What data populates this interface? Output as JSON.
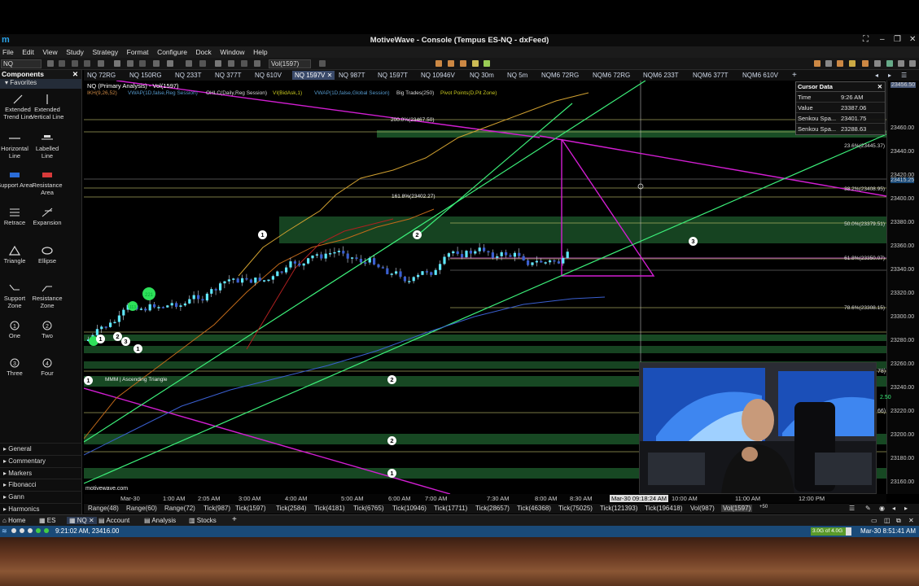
{
  "window": {
    "title": "MotiveWave - Console (Tempus ES-NQ - dxFeed)"
  },
  "menu": [
    "File",
    "Edit",
    "View",
    "Study",
    "Strategy",
    "Format",
    "Configure",
    "Dock",
    "Window",
    "Help"
  ],
  "toolbar": {
    "symbol": "NQ",
    "bartype": "Vol(1597)"
  },
  "sidebar": {
    "title": "Components",
    "favorites_label": "Favorites",
    "tools": [
      {
        "label": "Extended Trend Line",
        "icon": "trend-line-icon"
      },
      {
        "label": "Extended Vertical Line",
        "icon": "vertical-line-icon"
      },
      {
        "label": "Horizontal Line",
        "icon": "horizontal-line-icon"
      },
      {
        "label": "Labelled Line",
        "icon": "labelled-line-icon"
      },
      {
        "label": "Support Area",
        "icon": "support-area-icon"
      },
      {
        "label": "Resistance Area",
        "icon": "resistance-area-icon"
      },
      {
        "label": "Retrace",
        "icon": "retrace-icon"
      },
      {
        "label": "Expansion",
        "icon": "expansion-icon"
      },
      {
        "label": "Triangle",
        "icon": "triangle-icon"
      },
      {
        "label": "Ellipse",
        "icon": "ellipse-icon"
      },
      {
        "label": "Support Zone",
        "icon": "support-zone-icon"
      },
      {
        "label": "Resistance Zone",
        "icon": "resistance-zone-icon"
      },
      {
        "label": "One",
        "icon": "one-icon"
      },
      {
        "label": "Two",
        "icon": "two-icon"
      },
      {
        "label": "Three",
        "icon": "three-icon"
      },
      {
        "label": "Four",
        "icon": "four-icon"
      }
    ],
    "categories": [
      "General",
      "Commentary",
      "Markers",
      "Fibonacci",
      "Gann",
      "Harmonics"
    ]
  },
  "chart_tabs": [
    "NQ 72RG",
    "NQ 150RG",
    "NQ 233T",
    "NQ 377T",
    "NQ 610V",
    "NQ 1597V",
    "NQ 987T",
    "NQ 1597T",
    "NQ 10946V",
    "NQ 30m",
    "NQ 5m",
    "NQM6 72RG",
    "NQM6 72RG",
    "NQM6 233T",
    "NQM6 377T",
    "NQM6 610V"
  ],
  "chart": {
    "header": "NQ (Primary Analysis) - Vol(1597)",
    "studies": [
      "IKH(9,26,52)",
      "VWAP(1D,false,Reg Session)",
      "OHLC(Daily,Reg Session)",
      "VI(BidAsk,1)",
      "VWAP(1D,false,Global Session)",
      "Big Trades(250)",
      "Pivot Points(D,Pit Zone)"
    ],
    "watermark": "motivewave.com",
    "pattern_label": "MMM | Ascending Triangle",
    "fib_labels": [
      {
        "text": "200.0%(23467.50)"
      },
      {
        "text": "161.8%(23402.27)"
      },
      {
        "text": "23.6%(23445.37)"
      },
      {
        "text": "38.2%(23408.95)"
      },
      {
        "text": "50.0%(23379.51)"
      },
      {
        "text": "61.8%(23350.07)"
      },
      {
        "text": "78.6%(23308.15)"
      }
    ],
    "wave_labels": [
      "1",
      "2",
      "3",
      "1",
      "1",
      "2",
      "3",
      "1",
      "2",
      "2",
      "1"
    ],
    "green_bubbles": [
      "221",
      "113"
    ],
    "price_labels": [
      "23456.50",
      "23460.00",
      "23440.00",
      "23420.00",
      "23415.25",
      "23400.00",
      "23380.00",
      "23360.00",
      "23340.00",
      "23320.00",
      "23300.00",
      "23280.00",
      "23260.00",
      "23240.00",
      "23220.00",
      "23200.00",
      "23180.00",
      "23160.00"
    ],
    "price_partial": [
      "78)",
      "2.50",
      "66)"
    ],
    "time_labels": [
      "Mar-30",
      "1:00 AM",
      "2:05 AM",
      "3:00 AM",
      "4:00 AM",
      "5:00 AM",
      "6:00 AM",
      "7:00 AM",
      "7:30 AM",
      "8:00 AM",
      "8:30 AM",
      "10:00 AM",
      "11:00 AM",
      "12:00 PM"
    ],
    "cursor_time": "Mar-30 09:18:24 AM"
  },
  "cursor_data": {
    "title": "Cursor Data",
    "rows": [
      {
        "k": "Time",
        "v": "9:26 AM"
      },
      {
        "k": "Value",
        "v": "23387.06"
      },
      {
        "k": "Senkou Spa...",
        "v": "23401.75"
      },
      {
        "k": "Senkou Spa...",
        "v": "23288.63"
      }
    ]
  },
  "bar_types": [
    "Range(48)",
    "Range(60)",
    "Range(72)",
    "Tick(987)",
    "Tick(1597)",
    "Tick(2584)",
    "Tick(4181)",
    "Tick(6765)",
    "Tick(10946)",
    "Tick(17711)",
    "Tick(28657)",
    "Tick(46368)",
    "Tick(75025)",
    "Tick(121393)",
    "Tick(196418)",
    "Vol(987)",
    "Vol(1597)",
    "+50"
  ],
  "bottom_tabs": [
    "Home",
    "ES",
    "NQ",
    "Account",
    "Analysis",
    "Stocks"
  ],
  "status": {
    "text": "9:21:02 AM, 23416.00",
    "memory": "3.0G of 4.0G",
    "datetime": "Mar-30 8:51:41 AM"
  },
  "colors": {
    "accent": "#1a4a78",
    "support_band": "#1d5a2c",
    "fib_line": "#c8c870",
    "magenta_line": "#d21ed2",
    "green_line": "#3cf07a"
  }
}
